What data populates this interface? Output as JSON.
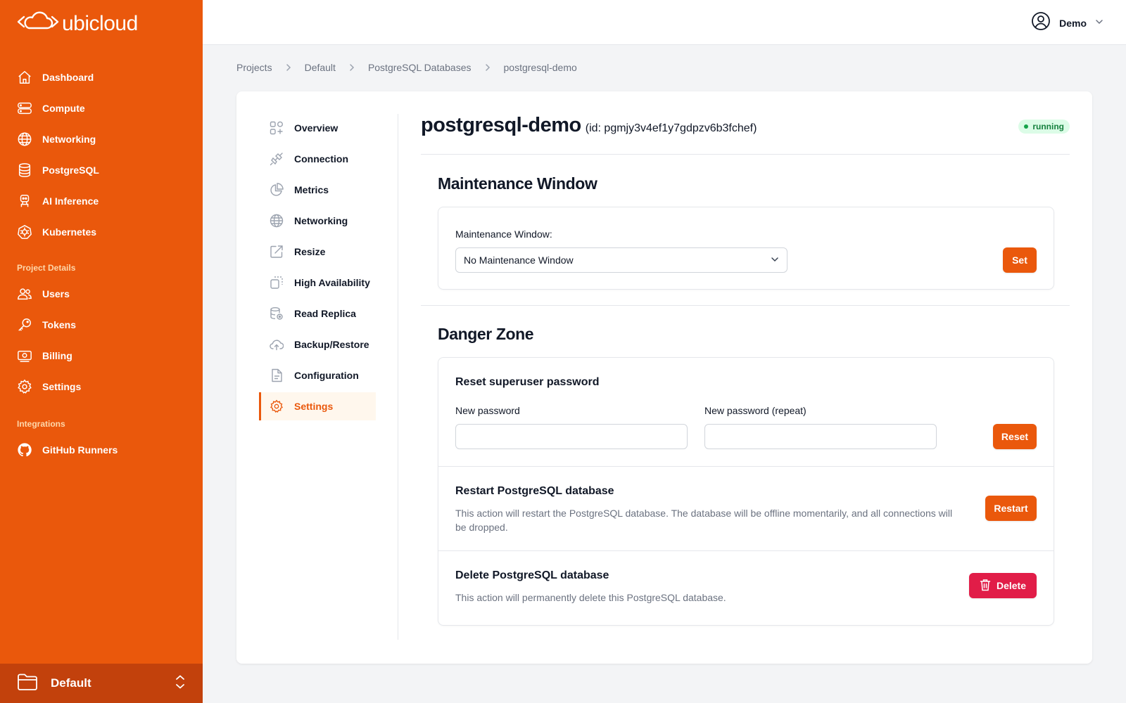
{
  "brand": {
    "name": "ubicloud"
  },
  "sidebar": {
    "main_items": [
      {
        "label": "Dashboard",
        "icon": "home-icon"
      },
      {
        "label": "Compute",
        "icon": "server-icon"
      },
      {
        "label": "Networking",
        "icon": "globe-icon"
      },
      {
        "label": "PostgreSQL",
        "icon": "database-icon"
      },
      {
        "label": "AI Inference",
        "icon": "robot-icon"
      },
      {
        "label": "Kubernetes",
        "icon": "kubernetes-icon"
      }
    ],
    "project_section_label": "Project Details",
    "project_items": [
      {
        "label": "Users",
        "icon": "users-icon"
      },
      {
        "label": "Tokens",
        "icon": "key-icon"
      },
      {
        "label": "Billing",
        "icon": "billing-icon"
      },
      {
        "label": "Settings",
        "icon": "gear-icon"
      }
    ],
    "integrations_section_label": "Integrations",
    "integration_items": [
      {
        "label": "GitHub Runners",
        "icon": "github-icon"
      }
    ],
    "project_switcher": {
      "label": "Default"
    }
  },
  "topbar": {
    "user_name": "Demo"
  },
  "breadcrumb": [
    "Projects",
    "Default",
    "PostgreSQL Databases",
    "postgresql-demo"
  ],
  "subnav": {
    "items": [
      {
        "label": "Overview",
        "icon": "overview-icon"
      },
      {
        "label": "Connection",
        "icon": "plug-icon"
      },
      {
        "label": "Metrics",
        "icon": "pie-chart-icon"
      },
      {
        "label": "Networking",
        "icon": "globe-icon"
      },
      {
        "label": "Resize",
        "icon": "resize-icon"
      },
      {
        "label": "High Availability",
        "icon": "high-availability-icon"
      },
      {
        "label": "Read Replica",
        "icon": "read-replica-icon"
      },
      {
        "label": "Backup/Restore",
        "icon": "cloud-upload-icon"
      },
      {
        "label": "Configuration",
        "icon": "document-icon"
      },
      {
        "label": "Settings",
        "icon": "gear-icon"
      }
    ],
    "active": "Settings"
  },
  "resource": {
    "name": "postgresql-demo",
    "id_text": "(id: pgmjy3v4ef1y7gdpzv6b3fchef)",
    "status": "running"
  },
  "maintenance": {
    "title": "Maintenance Window",
    "field_label": "Maintenance Window:",
    "selected": "No Maintenance Window",
    "button": "Set"
  },
  "danger_zone": {
    "title": "Danger Zone",
    "reset": {
      "title": "Reset superuser password",
      "new_password_label": "New password",
      "repeat_password_label": "New password (repeat)",
      "new_password_value": "",
      "repeat_password_value": "",
      "button": "Reset"
    },
    "restart": {
      "title": "Restart PostgreSQL database",
      "description": "This action will restart the PostgreSQL database. The database will be offline momentarily, and all connections will be dropped.",
      "button": "Restart"
    },
    "delete": {
      "title": "Delete PostgreSQL database",
      "description": "This action will permanently delete this PostgreSQL database.",
      "button": "Delete"
    }
  },
  "colors": {
    "brand": "#ea580c",
    "danger": "#e11d48",
    "status_bg": "#dcfce7",
    "status_text": "#15803d"
  }
}
